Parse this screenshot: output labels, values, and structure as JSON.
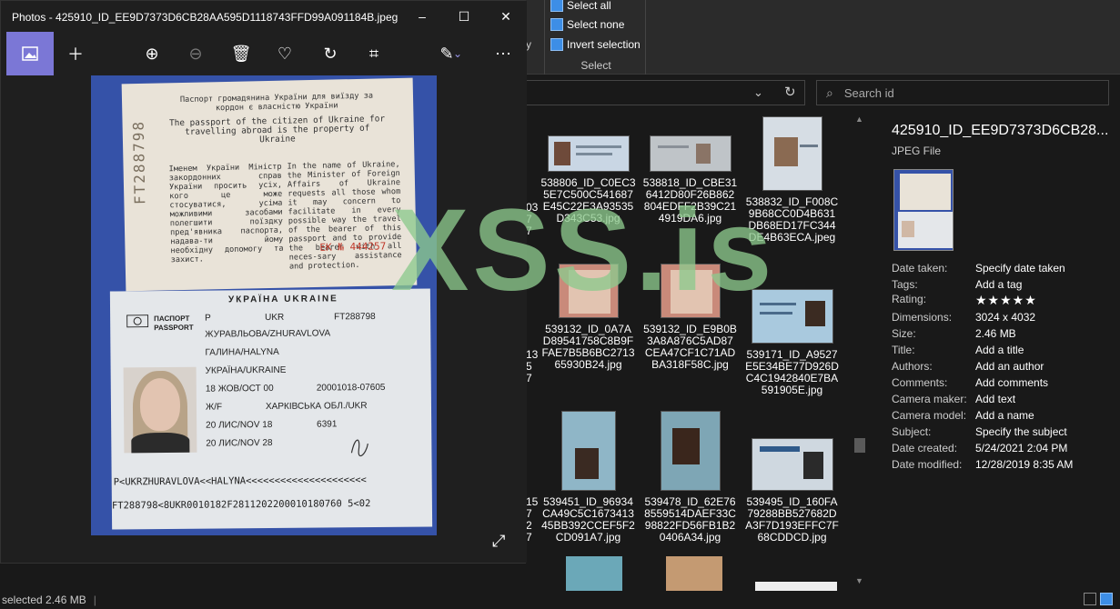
{
  "photos_app": {
    "title": "Photos - 425910_ID_EE9D7373D6CB28AA595D1118743FFD99A091184B.jpeg",
    "window_controls": [
      "–",
      "☐",
      "✕"
    ],
    "toolbar_icons": [
      "image-icon",
      "add-icon",
      "zoom-in-icon",
      "zoom-out-icon",
      "delete-icon",
      "favorite-icon",
      "rotate-icon",
      "crop-icon",
      "edit-icon",
      "more-icon"
    ],
    "expand_icon": "⤢"
  },
  "passport": {
    "top_title_ua": "Паспорт громадянина України для виїзду за кордон є власністю України",
    "top_title_en": "The passport of the citizen of Ukraine for travelling abroad is the property of Ukraine",
    "para_ua": "Іменем України Міністр закордонних справ України просить усіх, кого це може стосуватися, усіма можливими засобами полегшити поїздку пред'явника паспорта, надава-ти йому необхідну допомогу та захист.",
    "para_en": "In the name of Ukraine, the Minister of Foreign Affairs of Ukraine requests all those whom it may concern to facilitate in every possible way the travel of the bearer of this passport and to provide the bearer with all neces-sary assistance and protection.",
    "serial": "ЕК № 444257",
    "vertical_number": "FT288798",
    "header": "УКРАЇНА  UKRAINE",
    "doc_label": "ПАСПОРТ PASSPORT",
    "type": "P",
    "country": "UKR",
    "passport_no": "FT288798",
    "surname": "ЖУРАВЛЬОВА/ZHURAVLOVA",
    "given_names": "ГАЛИНА/HALYNA",
    "nationality": "УКРАЇНА/UKRAINE",
    "dob": "18 ЖОВ/ОСТ 00",
    "record_no": "20001018-07605",
    "sex": "Ж/F",
    "place_of_birth": "ХАРКІВСЬКА ОБЛ./UKR",
    "issue_date": "20 ЛИС/NOV 18",
    "authority": "6391",
    "expiry": "20 ЛИС/NOV 28",
    "mrz1": "P<UKRZHURAVLOVA<<HALYNA<<<<<<<<<<<<<<<<<<<<<",
    "mrz2": "FT288798<8UKR0010182F2811202200010180760 5<02"
  },
  "ribbon": {
    "select_all": "Select all",
    "select_none": "Select none",
    "invert_selection": "Invert selection",
    "group_caption": "Select",
    "partial_letter": "y"
  },
  "search": {
    "placeholder": "Search id"
  },
  "files": [
    {
      "name": "538806_ID_C0EC35E7C500C541687E45C22E3A93535D343C53.jpg",
      "label": "538806_ID_C0EC3\n5E7C500C541687\nE45C22E3A93535\nD343C53.jpg"
    },
    {
      "name": "538818_ID_CBE316412D80F26B862804EDFF2B39C214919DA6.jpg",
      "label": "538818_ID_CBE31\n6412D80F26B862\n804EDFF2B39C21\n4919DA6.jpg"
    },
    {
      "name": "538832_ID_F008C9B68CC0D4B631DB68ED17FC344DE4B63ECA.jpeg",
      "label": "538832_ID_F008C\n9B68CC0D4B631\nDB68ED17FC344\nDE4B63ECA.jpeg"
    },
    {
      "name": "539132_ID_0A7AD89541758C8B9FFAE7B5B6BC271365930B24.jpg",
      "label": "539132_ID_0A7A\nD89541758C8B9F\nFAE7B5B6BC2713\n65930B24.jpg"
    },
    {
      "name": "539132_ID_E9B0B3A8A876C5AD87CEA47CF1C71ADBA318F58C.jpg",
      "label": "539132_ID_E9B0B\n3A8A876C5AD87\nCEA47CF1C71AD\nBA318F58C.jpg"
    },
    {
      "name": "539171_ID_A9527E5E34BE77D926DC4C1942840E7BA591905E.jpg",
      "label": "539171_ID_A9527\nE5E34BE77D926D\nC4C1942840E7BA\n591905E.jpg"
    },
    {
      "name": "539451_ID_96934CA49C5C167341345BB392CCEF5F2CD091A7.jpg",
      "label": "539451_ID_96934\nCA49C5C1673413\n45BB392CCEF5F2\nCD091A7.jpg"
    },
    {
      "name": "539478_ID_62E768559514DAEF33C98822FD56FB1B20406A34.jpg",
      "label": "539478_ID_62E76\n8559514DAEF33C\n98822FD56FB1B2\n0406A34.jpg"
    },
    {
      "name": "539495_ID_160FA79288BB527682DA3F7D193EFFC7F68CDDCD.jpg",
      "label": "539495_ID_160FA\n79288BB527682D\nA3F7D193EFFC7F\n68CDDCD.jpg"
    }
  ],
  "partial_col": {
    "r1": "03\n7\n7",
    "r2": "13\n5\n7",
    "r3": "15\n7\n2\n7"
  },
  "details": {
    "name": "425910_ID_EE9D7373D6CB28...",
    "type": "JPEG File",
    "rows": [
      {
        "k": "Date taken:",
        "v": "Specify date taken"
      },
      {
        "k": "Tags:",
        "v": "Add a tag"
      },
      {
        "k": "Rating:",
        "v": "★★★★★"
      },
      {
        "k": "Dimensions:",
        "v": "3024 x 4032"
      },
      {
        "k": "Size:",
        "v": "2.46 MB"
      },
      {
        "k": "Title:",
        "v": "Add a title"
      },
      {
        "k": "Authors:",
        "v": "Add an author"
      },
      {
        "k": "Comments:",
        "v": "Add comments"
      },
      {
        "k": "Camera maker:",
        "v": "Add text"
      },
      {
        "k": "Camera model:",
        "v": "Add a name"
      },
      {
        "k": "Subject:",
        "v": "Specify the subject"
      },
      {
        "k": "Date created:",
        "v": "5/24/2021 2:04 PM"
      },
      {
        "k": "Date modified:",
        "v": "12/28/2019 8:35 AM"
      }
    ]
  },
  "status": {
    "text": "selected  2.46 MB"
  },
  "watermark": "XSS.is"
}
